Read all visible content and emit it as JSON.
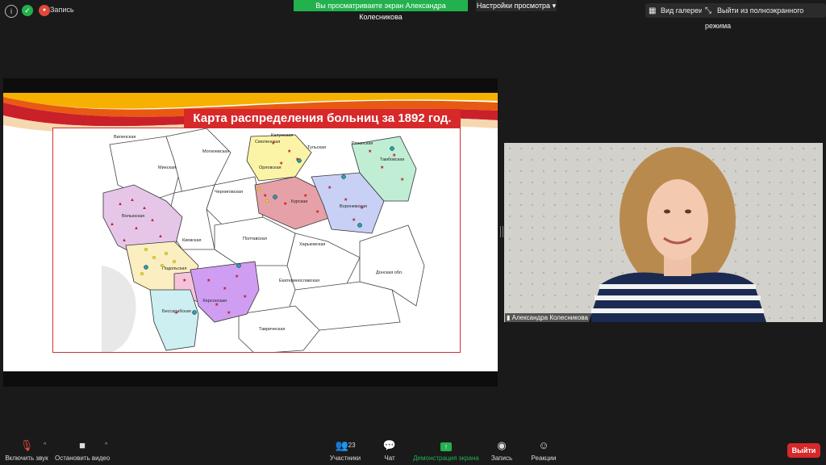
{
  "topbar": {
    "recording_label": "Запись",
    "share_banner": "Вы просматриваете экран Александра Колесникова",
    "view_options": "Настройки просмотра",
    "gallery_view": "Вид галереи",
    "exit_fullscreen": "Выйти из полноэкранного режима"
  },
  "slide": {
    "title": "Карта распределения больниц за 1892 год.",
    "regions": [
      "Виленская",
      "Минская",
      "Могилевская",
      "Смоленская",
      "Калужская",
      "Тульская",
      "Рязанская",
      "Тамбовская",
      "Орловская",
      "Черниговская",
      "Курская",
      "Воронежская",
      "Волынская",
      "Киевская",
      "Полтавская",
      "Харьковская",
      "Подольская",
      "Херсонская",
      "Екатеринославская",
      "Донская обл.",
      "Бессарабская",
      "Таврическая"
    ]
  },
  "video": {
    "participant_name": "Александра Колесникова"
  },
  "toolbar": {
    "mute_label": "Включить звук",
    "video_label": "Остановить видео",
    "participants_label": "Участники",
    "participants_count": "23",
    "chat_label": "Чат",
    "share_label": "Демонстрация экрана",
    "record_label": "Запись",
    "reactions_label": "Реакции",
    "leave_label": "Выйти"
  },
  "colors": {
    "share_green": "#22b14c",
    "title_red": "#d7282a",
    "leave_red": "#d7282a"
  }
}
